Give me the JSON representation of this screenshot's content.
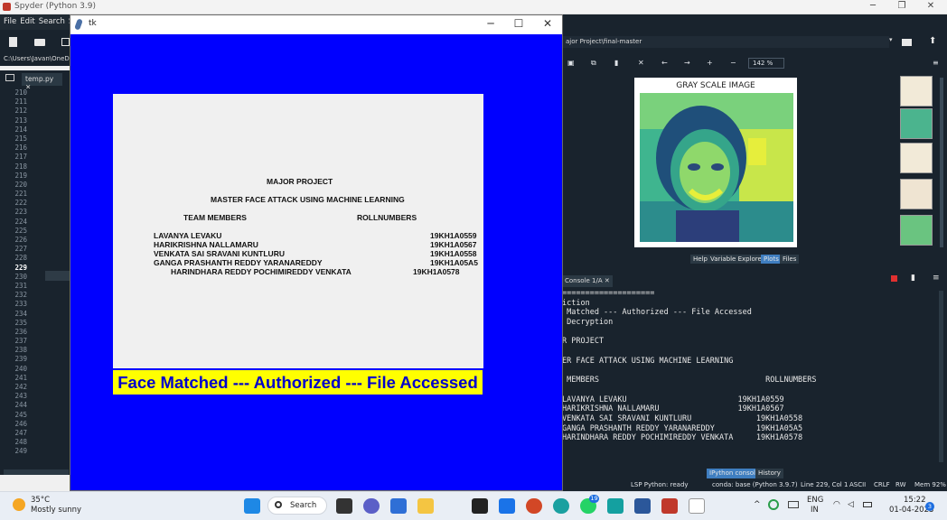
{
  "spyder": {
    "title": "Spyder (Python 3.9)",
    "menu": [
      "File",
      "Edit",
      "Search",
      "Sc"
    ],
    "path": "C:\\Users\\Javan\\OneDr",
    "editor_tab": "temp.py",
    "line_numbers": [
      "210",
      "211",
      "212",
      "213",
      "214",
      "215",
      "216",
      "217",
      "218",
      "219",
      "220",
      "221",
      "222",
      "223",
      "224",
      "225",
      "226",
      "227",
      "228",
      "229",
      "230",
      "231",
      "232",
      "233",
      "234",
      "235",
      "236",
      "237",
      "238",
      "239",
      "240",
      "241",
      "242",
      "243",
      "244",
      "245",
      "246",
      "247",
      "248",
      "249"
    ],
    "current_line": "229",
    "right_path": "ajor Project\\final-master",
    "zoom": "142 %",
    "plot_title": "GRAY SCALE IMAGE",
    "pane_tabs": [
      "Help",
      "Variable Explorer",
      "Plots",
      "Files"
    ],
    "console_tab": "Console 1/A",
    "console_lines": [
      "====================",
      "iction",
      " Matched --- Authorized --- File Accessed",
      " Decryption",
      "",
      "R PROJECT",
      "",
      "ER FACE ATTACK USING MACHINE LEARNING",
      "",
      " MEMBERS                                    ROLLNUMBERS",
      "",
      "LAVANYA LEVAKU                        19KH1A0559",
      "HARIKRISHNA NALLAMARU                 19KH1A0567",
      "VENKATA SAI SRAVANI KUNTLURU              19KH1A0558",
      "GANGA PRASHANTH REDDY YARANAREDDY         19KH1A05A5",
      "HARINDHARA REDDY POCHIMIREDDY VENKATA     19KH1A0578"
    ],
    "console_tabs": [
      "IPython console",
      "History"
    ],
    "status": {
      "lsp": "LSP Python: ready",
      "env": "conda: base (Python 3.9.7)",
      "pos": "Line 229, Col 1",
      "enc": "ASCII",
      "eol": "CRLF",
      "rw": "RW",
      "mem": "Mem 92%"
    }
  },
  "tk": {
    "title": "tk",
    "heading": "MAJOR PROJECT",
    "subtitle": "MASTER FACE ATTACK USING MACHINE LEARNING",
    "col_members": "TEAM MEMBERS",
    "col_roll": "ROLLNUMBERS",
    "members": [
      {
        "name": "LAVANYA LEVAKU",
        "roll": "19KH1A0559"
      },
      {
        "name": "HARIKRISHNA NALLAMARU",
        "roll": "19KH1A0567"
      },
      {
        "name": "VENKATA SAI SRAVANI KUNTLURU",
        "roll": "19KH1A0558"
      },
      {
        "name": "GANGA PRASHANTH REDDY YARANAREDDY",
        "roll": "19KH1A05A5"
      },
      {
        "name": "HARINDHARA REDDY POCHIMIREDDY VENKATA",
        "roll": "19KH1A0578"
      }
    ],
    "banner": "Face Matched --- Authorized --- File Accessed",
    "banner_bg": "#ffff00",
    "banner_fg": "#0000cc",
    "window_bg": "#0000ff"
  },
  "taskbar": {
    "temp": "35°C",
    "weather": "Mostly sunny",
    "search": "Search",
    "whatsapp_badge": "19",
    "lang1": "ENG",
    "lang2": "IN",
    "time": "15:22",
    "date": "01-04-2023",
    "notif": "3"
  }
}
